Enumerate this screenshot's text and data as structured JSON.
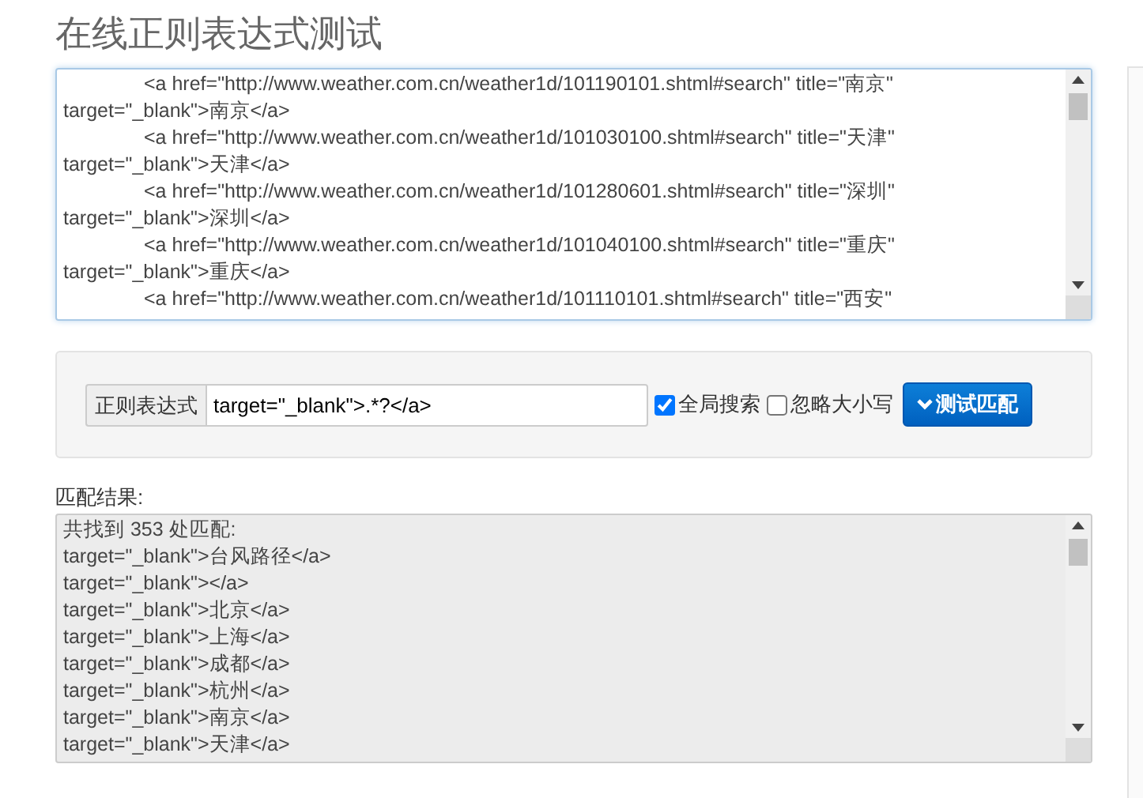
{
  "title": "在线正则表达式测试",
  "source": {
    "lines": [
      {
        "text": "<a href=\"http://www.weather.com.cn/weather1d/101190101.shtml#search\" title=\"南京\"",
        "indented": true
      },
      {
        "text": "target=\"_blank\">南京</a>",
        "indented": false
      },
      {
        "text": "<a href=\"http://www.weather.com.cn/weather1d/101030100.shtml#search\" title=\"天津\"",
        "indented": true
      },
      {
        "text": "target=\"_blank\">天津</a>",
        "indented": false
      },
      {
        "text": "<a href=\"http://www.weather.com.cn/weather1d/101280601.shtml#search\" title=\"深圳\"",
        "indented": true
      },
      {
        "text": "target=\"_blank\">深圳</a>",
        "indented": false
      },
      {
        "text": "<a href=\"http://www.weather.com.cn/weather1d/101040100.shtml#search\" title=\"重庆\"",
        "indented": true
      },
      {
        "text": "target=\"_blank\">重庆</a>",
        "indented": false
      },
      {
        "text": "<a href=\"http://www.weather.com.cn/weather1d/101110101.shtml#search\" title=\"西安\"",
        "indented": true
      }
    ]
  },
  "form": {
    "addon": "正则表达式",
    "value": "target=\"_blank\">.*?</a>",
    "options": [
      {
        "label": "全局搜索",
        "checked": true
      },
      {
        "label": "忽略大小写",
        "checked": false
      }
    ],
    "button": "测试匹配"
  },
  "result": {
    "label": "匹配结果:",
    "lines": [
      "共找到 353 处匹配:",
      "target=\"_blank\">台风路径</a>",
      "target=\"_blank\"></a>",
      "target=\"_blank\">北京</a>",
      "target=\"_blank\">上海</a>",
      "target=\"_blank\">成都</a>",
      "target=\"_blank\">杭州</a>",
      "target=\"_blank\">南京</a>",
      "target=\"_blank\">天津</a>"
    ]
  }
}
